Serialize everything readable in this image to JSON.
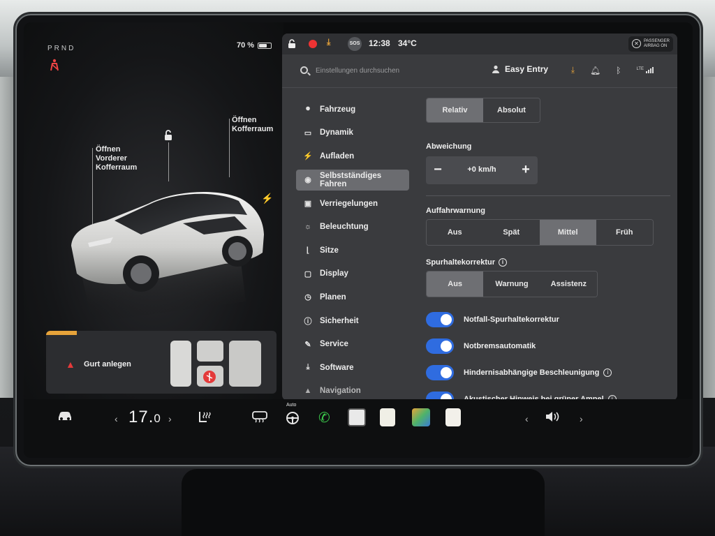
{
  "car": {
    "gear": "PRND",
    "battery_percent_label": "70 %",
    "battery_level": 0.7,
    "frunk_label_line1": "Öffnen",
    "frunk_label_line2": "Vorderer",
    "frunk_label_line3": "Kofferraum",
    "trunk_label_line1": "Öffnen",
    "trunk_label_line2": "Kofferraum",
    "alert_text": "Gurt anlegen"
  },
  "status": {
    "sos": "SOS",
    "time": "12:38",
    "temperature": "34°C",
    "airbag_line1": "PASSENGER",
    "airbag_line2": "AIRBAG ON",
    "signal_label": "LTE"
  },
  "search": {
    "placeholder": "Einstellungen durchsuchen"
  },
  "profile": {
    "name": "Easy Entry"
  },
  "nav": {
    "items": [
      {
        "label": "Fahrzeug",
        "icon": "toggle-icon"
      },
      {
        "label": "Dynamik",
        "icon": "car-icon"
      },
      {
        "label": "Aufladen",
        "icon": "bolt-icon"
      },
      {
        "label": "Selbstständiges\nFahren",
        "icon": "steering-wheel-icon",
        "active": true
      },
      {
        "label": "Verriegelungen",
        "icon": "lock-icon"
      },
      {
        "label": "Beleuchtung",
        "icon": "sun-icon"
      },
      {
        "label": "Sitze",
        "icon": "seat-icon"
      },
      {
        "label": "Display",
        "icon": "display-icon"
      },
      {
        "label": "Planen",
        "icon": "clock-icon"
      },
      {
        "label": "Sicherheit",
        "icon": "info-icon"
      },
      {
        "label": "Service",
        "icon": "wrench-icon"
      },
      {
        "label": "Software",
        "icon": "download-icon"
      },
      {
        "label": "Navigation",
        "icon": "navigation-icon"
      }
    ]
  },
  "speed_mode": {
    "options": [
      "Relativ",
      "Absolut"
    ],
    "selected": "Relativ"
  },
  "offset": {
    "label": "Abweichung",
    "value": "+0 km/h",
    "minus": "−",
    "plus": "+"
  },
  "forward_collision": {
    "label": "Auffahrwarnung",
    "options": [
      "Aus",
      "Spät",
      "Mittel",
      "Früh"
    ],
    "selected": "Mittel"
  },
  "lane_assist": {
    "label": "Spurhaltekorrektur",
    "options": [
      "Aus",
      "Warnung",
      "Assistenz"
    ],
    "selected": "Aus"
  },
  "toggles": [
    {
      "label": "Notfall-Spurhaltekorrektur",
      "on": true,
      "info": false
    },
    {
      "label": "Notbremsautomatik",
      "on": true,
      "info": false
    },
    {
      "label": "Hindernisabhängige Beschleunigung",
      "on": true,
      "info": true
    },
    {
      "label": "Akustischer Hinweis bei grüner Ampel",
      "on": true,
      "info": true
    }
  ],
  "dock": {
    "temp_main": "17.",
    "temp_decimal": "0",
    "wiper_label": "Auto",
    "prev": "‹",
    "next": "›"
  },
  "colors": {
    "accent_toggle": "#2f6ce0",
    "alert_red": "#e43a3a",
    "record_red": "#e33333",
    "download_orange": "#e7a33a"
  }
}
